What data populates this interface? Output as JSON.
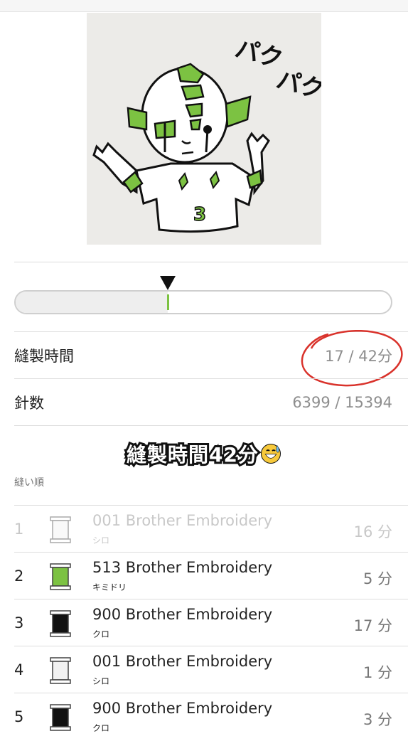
{
  "design": {
    "title_text_1": "パク",
    "title_text_2": "パク",
    "chest_mark": "3"
  },
  "progress": {
    "fraction": 0.4048,
    "colors": {
      "track": "#eeeeee",
      "marker": "#7cc242"
    }
  },
  "stats": {
    "sewing_time_label": "縫製時間",
    "sewing_time_value": "17 / 42分",
    "stitch_count_label": "針数",
    "stitch_count_value": "6399 / 15394"
  },
  "caption": {
    "text": "縫製時間42分",
    "emoji": "sweat-smile-emoji"
  },
  "order": {
    "label": "縫い順",
    "threads": [
      {
        "index": "1",
        "name": "001 Brother Embroidery",
        "color_name": "シロ",
        "minutes": "16 分",
        "color": "#f2f2f2",
        "done": true
      },
      {
        "index": "2",
        "name": "513 Brother Embroidery",
        "color_name": "キミドリ",
        "minutes": "5 分",
        "color": "#7cc242",
        "done": false
      },
      {
        "index": "3",
        "name": "900 Brother Embroidery",
        "color_name": "クロ",
        "minutes": "17 分",
        "color": "#111111",
        "done": false
      },
      {
        "index": "4",
        "name": "001 Brother Embroidery",
        "color_name": "シロ",
        "minutes": "1 分",
        "color": "#f2f2f2",
        "done": false
      },
      {
        "index": "5",
        "name": "900 Brother Embroidery",
        "color_name": "クロ",
        "minutes": "3 分",
        "color": "#111111",
        "done": false
      }
    ]
  },
  "accent_colors": {
    "annotation_circle": "#d9322b",
    "green": "#7cc242"
  }
}
